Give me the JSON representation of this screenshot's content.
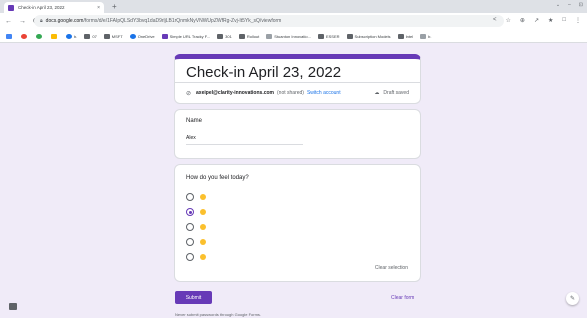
{
  "browser": {
    "tab_title": "Check-in April 23, 2022",
    "tab_close": "×",
    "new_tab": "+",
    "window_controls": [
      "⌄",
      "–",
      "⊡"
    ],
    "nav": {
      "back": "←",
      "forward": "→",
      "reload": "C"
    },
    "url_host": "docs.google.com",
    "url_path": "/forms/d/e/1FAIpQLSdY3bvq1daD9rljLB1rQnmkNyVNWUpZWfRg-Zvj-It5Yk_sQ/viewform",
    "toolbar_icons": [
      "<",
      "☆",
      "⊕",
      "↗",
      "★",
      "□",
      "⋮"
    ]
  },
  "bookmarks": [
    {
      "label": "",
      "icon": "apps"
    },
    {
      "label": "",
      "icon": "c1"
    },
    {
      "label": "",
      "icon": "c2"
    },
    {
      "label": "",
      "icon": "c3"
    },
    {
      "label": "b.",
      "icon": "c4"
    },
    {
      "label": "07",
      "icon": "folder"
    },
    {
      "label": "MSFT",
      "icon": "folder"
    },
    {
      "label": "OneDrive",
      "icon": "c4"
    },
    {
      "label": "Simple URL Tracky F...",
      "icon": "c5"
    },
    {
      "label": "301",
      "icon": "folder"
    },
    {
      "label": "Rollout",
      "icon": "folder"
    },
    {
      "label": "Stuanton Innovatio...",
      "icon": "c6"
    },
    {
      "label": "ESSER",
      "icon": "folder"
    },
    {
      "label": "Subscription Models",
      "icon": "folder"
    },
    {
      "label": "Intel",
      "icon": "folder"
    },
    {
      "label": "b.",
      "icon": "c6"
    }
  ],
  "form": {
    "title": "Check-in April 23, 2022",
    "account_email": "axeipel@clarity-innovations.com",
    "account_status": "(not shared)",
    "switch_account": "Switch account",
    "draft_status": "Draft saved",
    "name_question": "Name",
    "name_answer": "Alex",
    "feel_question": "How do you feel today?",
    "options": [
      {
        "emoji": "neutral-face",
        "selected": false
      },
      {
        "emoji": "smiling-face",
        "selected": true
      },
      {
        "emoji": "grinning-face",
        "selected": false
      },
      {
        "emoji": "confused-face",
        "selected": false
      },
      {
        "emoji": "crying-face",
        "selected": false
      }
    ],
    "clear_selection": "Clear selection",
    "submit": "Submit",
    "clear_form": "Clear form",
    "footer_note": "Never submit passwords through Google Forms."
  },
  "colors": {
    "accent": "#673ab7",
    "page_bg": "#f0ebf8",
    "link": "#1a73e8"
  }
}
